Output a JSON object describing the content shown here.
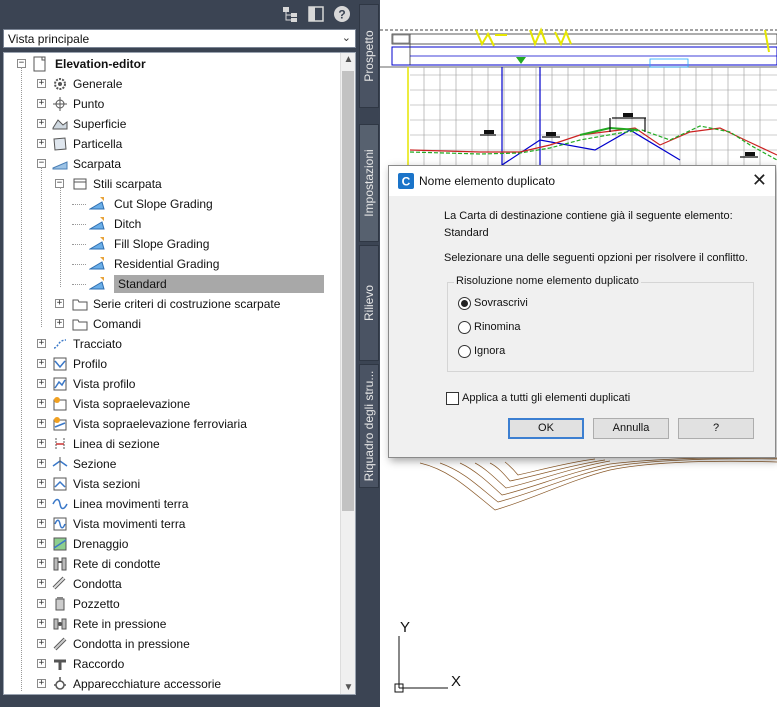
{
  "toolspace": {
    "view_selector": "Vista principale",
    "tree": [
      {
        "label": "Elevation-editor",
        "icon": "drawing-icon",
        "level": 0,
        "expander": "-",
        "bold": true
      },
      {
        "label": "Generale",
        "icon": "gear-icon",
        "level": 1,
        "expander": "+"
      },
      {
        "label": "Punto",
        "icon": "point-icon",
        "level": 1,
        "expander": "+"
      },
      {
        "label": "Superficie",
        "icon": "surface-icon",
        "level": 1,
        "expander": "+"
      },
      {
        "label": "Particella",
        "icon": "parcel-icon",
        "level": 1,
        "expander": "+"
      },
      {
        "label": "Scarpata",
        "icon": "grading-icon",
        "level": 1,
        "expander": "-"
      },
      {
        "label": "Stili scarpata",
        "icon": "style-folder-icon",
        "level": 2,
        "expander": "-"
      },
      {
        "label": "Cut Slope Grading",
        "icon": "grading-style-icon",
        "level": 3,
        "expander": ""
      },
      {
        "label": "Ditch",
        "icon": "grading-style-icon",
        "level": 3,
        "expander": ""
      },
      {
        "label": "Fill Slope Grading",
        "icon": "grading-style-icon",
        "level": 3,
        "expander": ""
      },
      {
        "label": "Residential Grading",
        "icon": "grading-style-icon",
        "level": 3,
        "expander": ""
      },
      {
        "label": "Standard",
        "icon": "grading-style-icon",
        "level": 3,
        "expander": "",
        "selected": true
      },
      {
        "label": "Serie criteri di costruzione scarpate",
        "icon": "folder-icon",
        "level": 2,
        "expander": "+"
      },
      {
        "label": "Comandi",
        "icon": "folder-icon",
        "level": 2,
        "expander": "+"
      },
      {
        "label": "Tracciato",
        "icon": "alignment-icon",
        "level": 1,
        "expander": "+"
      },
      {
        "label": "Profilo",
        "icon": "profile-icon",
        "level": 1,
        "expander": "+"
      },
      {
        "label": "Vista profilo",
        "icon": "profile-view-icon",
        "level": 1,
        "expander": "+"
      },
      {
        "label": "Vista sopraelevazione",
        "icon": "superelevation-view-icon",
        "level": 1,
        "expander": "+"
      },
      {
        "label": "Vista sopraelevazione ferroviaria",
        "icon": "rail-superelevation-icon",
        "level": 1,
        "expander": "+"
      },
      {
        "label": "Linea di sezione",
        "icon": "sample-line-icon",
        "level": 1,
        "expander": "+"
      },
      {
        "label": "Sezione",
        "icon": "section-icon",
        "level": 1,
        "expander": "+"
      },
      {
        "label": "Vista sezioni",
        "icon": "section-view-icon",
        "level": 1,
        "expander": "+"
      },
      {
        "label": "Linea movimenti terra",
        "icon": "mass-haul-line-icon",
        "level": 1,
        "expander": "+"
      },
      {
        "label": "Vista movimenti terra",
        "icon": "mass-haul-view-icon",
        "level": 1,
        "expander": "+"
      },
      {
        "label": "Drenaggio",
        "icon": "catchment-icon",
        "level": 1,
        "expander": "+"
      },
      {
        "label": "Rete di condotte",
        "icon": "pipe-network-icon",
        "level": 1,
        "expander": "+"
      },
      {
        "label": "Condotta",
        "icon": "pipe-icon",
        "level": 1,
        "expander": "+"
      },
      {
        "label": "Pozzetto",
        "icon": "structure-icon",
        "level": 1,
        "expander": "+"
      },
      {
        "label": "Rete in pressione",
        "icon": "pressure-network-icon",
        "level": 1,
        "expander": "+"
      },
      {
        "label": "Condotta in pressione",
        "icon": "pressure-pipe-icon",
        "level": 1,
        "expander": "+"
      },
      {
        "label": "Raccordo",
        "icon": "fitting-icon",
        "level": 1,
        "expander": "+"
      },
      {
        "label": "Apparecchiature accessorie",
        "icon": "appurtenance-icon",
        "level": 1,
        "expander": "+"
      }
    ]
  },
  "vertical_tabs": [
    "Prospetto",
    "Impostazioni",
    "Rilievo",
    "Riquadro degli stru..."
  ],
  "dialog": {
    "title": "Nome elemento duplicato",
    "message_line1": "La Carta di destinazione contiene già il seguente elemento:",
    "item_name": "Standard",
    "instruction": "Selezionare una delle seguenti opzioni per risolvere il conflitto.",
    "group_title": "Risoluzione nome elemento duplicato",
    "options": [
      "Sovrascrivi",
      "Rinomina",
      "Ignora"
    ],
    "selected_option": "Sovrascrivi",
    "apply_all_label": "Applica a tutti gli elementi duplicati",
    "apply_all_checked": false,
    "buttons": {
      "ok": "OK",
      "cancel": "Annulla",
      "help": "?"
    }
  },
  "drawing": {
    "ucs_x": "X",
    "ucs_y": "Y"
  },
  "colors": {
    "panel_bg": "#3b4453",
    "selection": "#a8a8a8",
    "default_button_border": "#3c7fd1",
    "grid_blue": "#0000cc",
    "drawing_yellow": "#e6e600",
    "drawing_green": "#22aa22",
    "drawing_red": "#cc2222"
  }
}
